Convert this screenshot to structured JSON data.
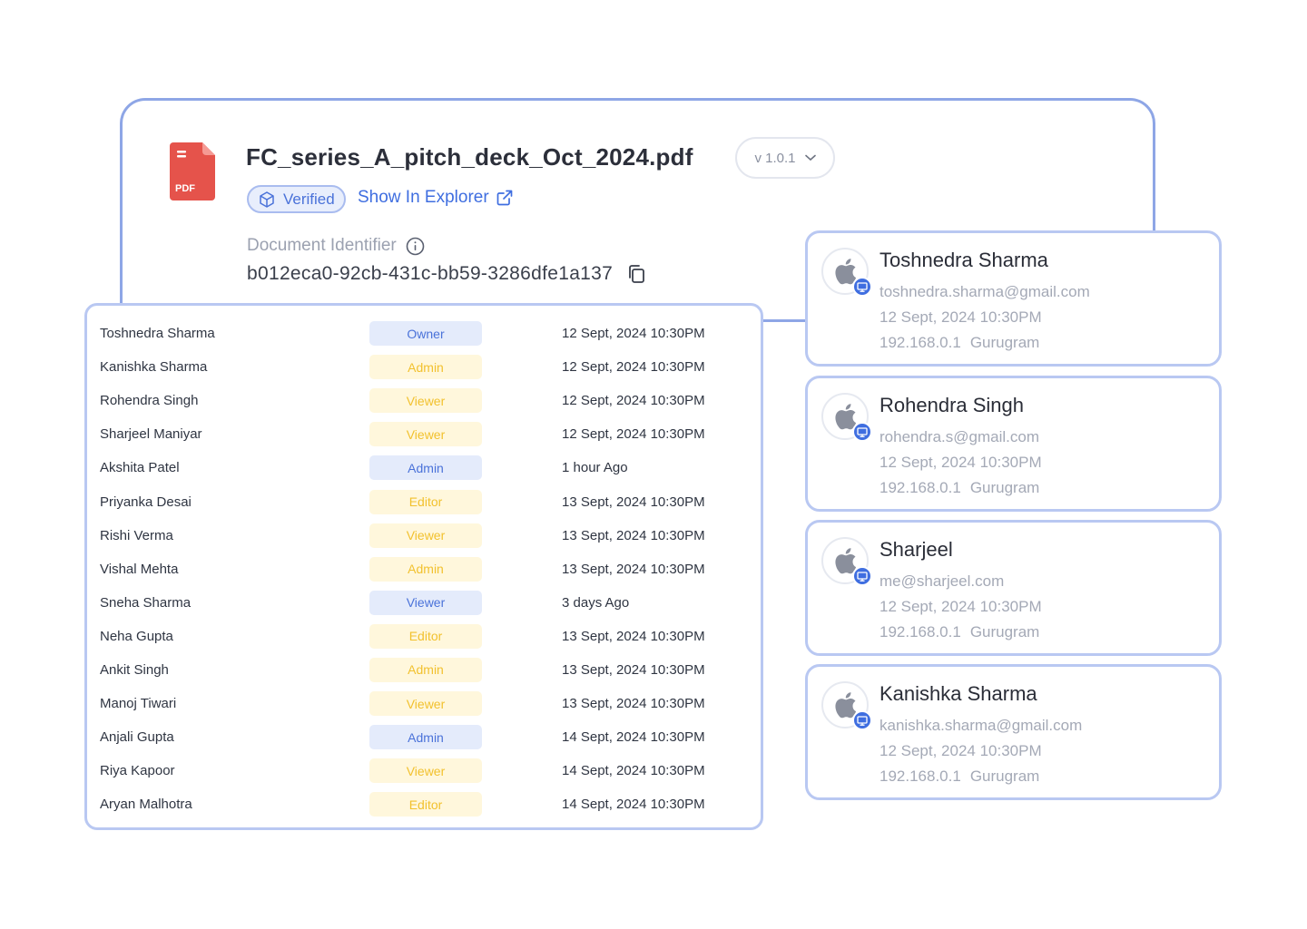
{
  "document": {
    "file_name": "FC_series_A_pitch_deck_Oct_2024.pdf",
    "file_type_label": "PDF",
    "version": "v 1.0.1",
    "verified_label": "Verified",
    "show_in_explorer_label": "Show In Explorer",
    "identifier_label": "Document Identifier",
    "identifier_value": "b012eca0-92cb-431c-bb59-3286dfe1a137"
  },
  "access_list": [
    {
      "name": "Toshnedra Sharma",
      "role": "Owner",
      "role_style": "blue",
      "time": "12 Sept, 2024 10:30PM"
    },
    {
      "name": "Kanishka Sharma",
      "role": "Admin",
      "role_style": "yellow",
      "time": "12 Sept, 2024 10:30PM"
    },
    {
      "name": "Rohendra Singh",
      "role": "Viewer",
      "role_style": "yellow",
      "time": "12 Sept, 2024 10:30PM"
    },
    {
      "name": "Sharjeel Maniyar",
      "role": "Viewer",
      "role_style": "yellow",
      "time": "12 Sept, 2024 10:30PM"
    },
    {
      "name": "Akshita Patel",
      "role": "Admin",
      "role_style": "blue",
      "time": "1 hour Ago"
    },
    {
      "name": "Priyanka Desai",
      "role": "Editor",
      "role_style": "yellow",
      "time": "13 Sept, 2024 10:30PM"
    },
    {
      "name": "Rishi Verma",
      "role": "Viewer",
      "role_style": "yellow",
      "time": "13 Sept, 2024 10:30PM"
    },
    {
      "name": "Vishal Mehta",
      "role": "Admin",
      "role_style": "yellow",
      "time": "13 Sept, 2024 10:30PM"
    },
    {
      "name": "Sneha Sharma",
      "role": "Viewer",
      "role_style": "blue",
      "time": "3 days Ago"
    },
    {
      "name": "Neha Gupta",
      "role": "Editor",
      "role_style": "yellow",
      "time": "13 Sept, 2024 10:30PM"
    },
    {
      "name": "Ankit Singh",
      "role": "Admin",
      "role_style": "yellow",
      "time": "13 Sept, 2024 10:30PM"
    },
    {
      "name": "Manoj Tiwari",
      "role": "Viewer",
      "role_style": "yellow",
      "time": "13 Sept, 2024 10:30PM"
    },
    {
      "name": "Anjali Gupta",
      "role": "Admin",
      "role_style": "blue",
      "time": "14 Sept, 2024 10:30PM"
    },
    {
      "name": "Riya Kapoor",
      "role": "Viewer",
      "role_style": "yellow",
      "time": "14 Sept, 2024 10:30PM"
    },
    {
      "name": "Aryan Malhotra",
      "role": "Editor",
      "role_style": "yellow",
      "time": "14 Sept, 2024 10:30PM"
    }
  ],
  "sessions": [
    {
      "name": "Toshnedra Sharma",
      "email": "toshnedra.sharma@gmail.com",
      "time": "12 Sept, 2024 10:30PM",
      "ip": "192.168.0.1",
      "location": "Gurugram",
      "os_icon": "apple-icon",
      "device_icon": "desktop-icon"
    },
    {
      "name": "Rohendra Singh",
      "email": "rohendra.s@gmail.com",
      "time": "12 Sept, 2024 10:30PM",
      "ip": "192.168.0.1",
      "location": "Gurugram",
      "os_icon": "apple-icon",
      "device_icon": "desktop-icon"
    },
    {
      "name": "Sharjeel",
      "email": "me@sharjeel.com",
      "time": "12 Sept, 2024 10:30PM",
      "ip": "192.168.0.1",
      "location": "Gurugram",
      "os_icon": "apple-icon",
      "device_icon": "desktop-icon"
    },
    {
      "name": "Kanishka Sharma",
      "email": "kanishka.sharma@gmail.com",
      "time": "12 Sept, 2024 10:30PM",
      "ip": "192.168.0.1",
      "location": "Gurugram",
      "os_icon": "apple-icon",
      "device_icon": "desktop-icon"
    }
  ],
  "colors": {
    "accent": "#3f6ee0",
    "card_border": "#8ea6e6",
    "role_blue_bg": "#e4ebfb",
    "role_yellow_bg": "#fff7dc",
    "role_yellow_text": "#f2c12e",
    "pdf_red": "#e5534b"
  }
}
